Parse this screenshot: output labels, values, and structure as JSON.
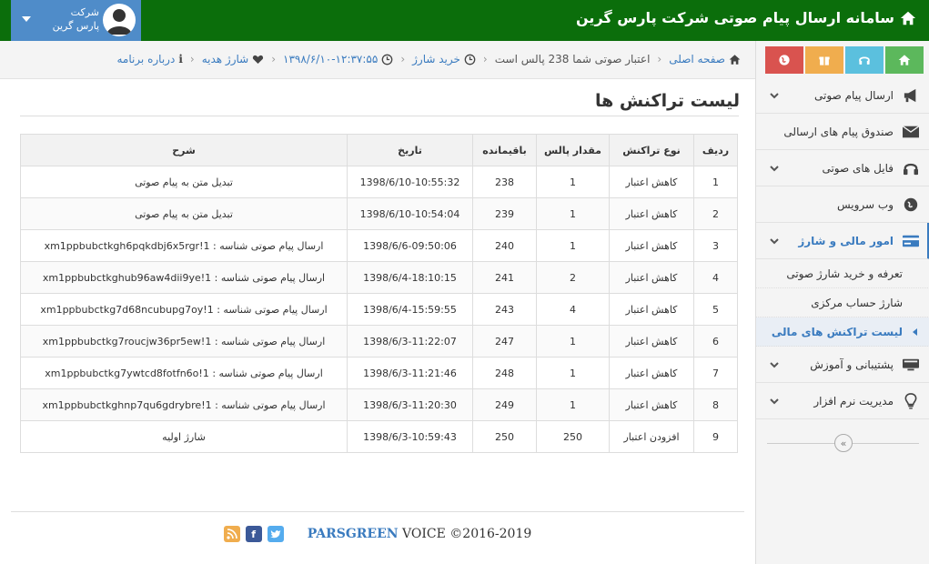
{
  "header": {
    "title": "سامانه ارسال پیام صوتی شرکت پارس گرین",
    "user_line1": "شرکت",
    "user_line2": "پارس گرین"
  },
  "breadcrumb": {
    "home": "صفحه اصلی",
    "credit": "اعتبار صوتی شما 238 پالس است",
    "buy": "خرید شارژ",
    "datetime": "۱۳۹۸/۶/۱۰-۱۲:۳۷:۵۵",
    "gift": "شارژ هدیه",
    "about": "درباره برنامه"
  },
  "sidebar": {
    "items": [
      {
        "label": "ارسال پیام صوتی",
        "icon": "megaphone-icon"
      },
      {
        "label": "صندوق پیام های ارسالی",
        "icon": "envelope-icon"
      },
      {
        "label": "فایل های صوتی",
        "icon": "headphones-icon"
      },
      {
        "label": "وب سرویس",
        "icon": "globe-icon"
      },
      {
        "label": "امور مالی و شارژ",
        "icon": "credit-card-icon"
      },
      {
        "label": "پشتیبانی و آموزش",
        "icon": "monitor-icon"
      },
      {
        "label": "مدیریت نرم افزار",
        "icon": "lightbulb-icon"
      }
    ],
    "submenu": [
      {
        "label": "تعرفه و خرید شارژ صوتی"
      },
      {
        "label": "شارژ حساب مرکزی"
      },
      {
        "label": "لیست تراکنش های مالی"
      }
    ]
  },
  "page": {
    "title": "لیست تراکنش ها"
  },
  "table": {
    "headers": [
      "ردیف",
      "نوع تراکنش",
      "مقدار پالس",
      "باقیمانده",
      "تاریخ",
      "شرح"
    ],
    "rows": [
      [
        "1",
        "کاهش اعتبار",
        "1",
        "238",
        "1398/6/10-10:55:32",
        "تبدیل متن به پیام صوتی"
      ],
      [
        "2",
        "کاهش اعتبار",
        "1",
        "239",
        "1398/6/10-10:54:04",
        "تبدیل متن به پیام صوتی"
      ],
      [
        "3",
        "کاهش اعتبار",
        "1",
        "240",
        "1398/6/6-09:50:06",
        "ارسال پیام صوتی شناسه : xm1ppbubctkgh6pqkdbj6x5rgr!1"
      ],
      [
        "4",
        "کاهش اعتبار",
        "2",
        "241",
        "1398/6/4-18:10:15",
        "ارسال پیام صوتی شناسه : xm1ppbubctkghub96aw4dii9ye!1"
      ],
      [
        "5",
        "کاهش اعتبار",
        "4",
        "243",
        "1398/6/4-15:59:55",
        "ارسال پیام صوتی شناسه : xm1ppbubctkg7d68ncubupg7oy!1"
      ],
      [
        "6",
        "کاهش اعتبار",
        "1",
        "247",
        "1398/6/3-11:22:07",
        "ارسال پیام صوتی شناسه : xm1ppbubctkg7roucjw36pr5ew!1"
      ],
      [
        "7",
        "کاهش اعتبار",
        "1",
        "248",
        "1398/6/3-11:21:46",
        "ارسال پیام صوتی شناسه : xm1ppbubctkg7ywtcd8fotfn6o!1"
      ],
      [
        "8",
        "کاهش اعتبار",
        "1",
        "249",
        "1398/6/3-11:20:30",
        "ارسال پیام صوتی شناسه : xm1ppbubctkghnp7qu6gdrybre!1"
      ],
      [
        "9",
        "افزودن اعتبار",
        "250",
        "250",
        "1398/6/3-10:59:43",
        "شارژ اولیه"
      ]
    ]
  },
  "footer": {
    "brand": "PARSGREEN",
    "product": "VOICE",
    "copyright": "©2016-2019"
  },
  "colors": {
    "header_green": "#0b6e0b",
    "user_blue": "#4f8cc9",
    "link_blue": "#3a7bbf"
  }
}
